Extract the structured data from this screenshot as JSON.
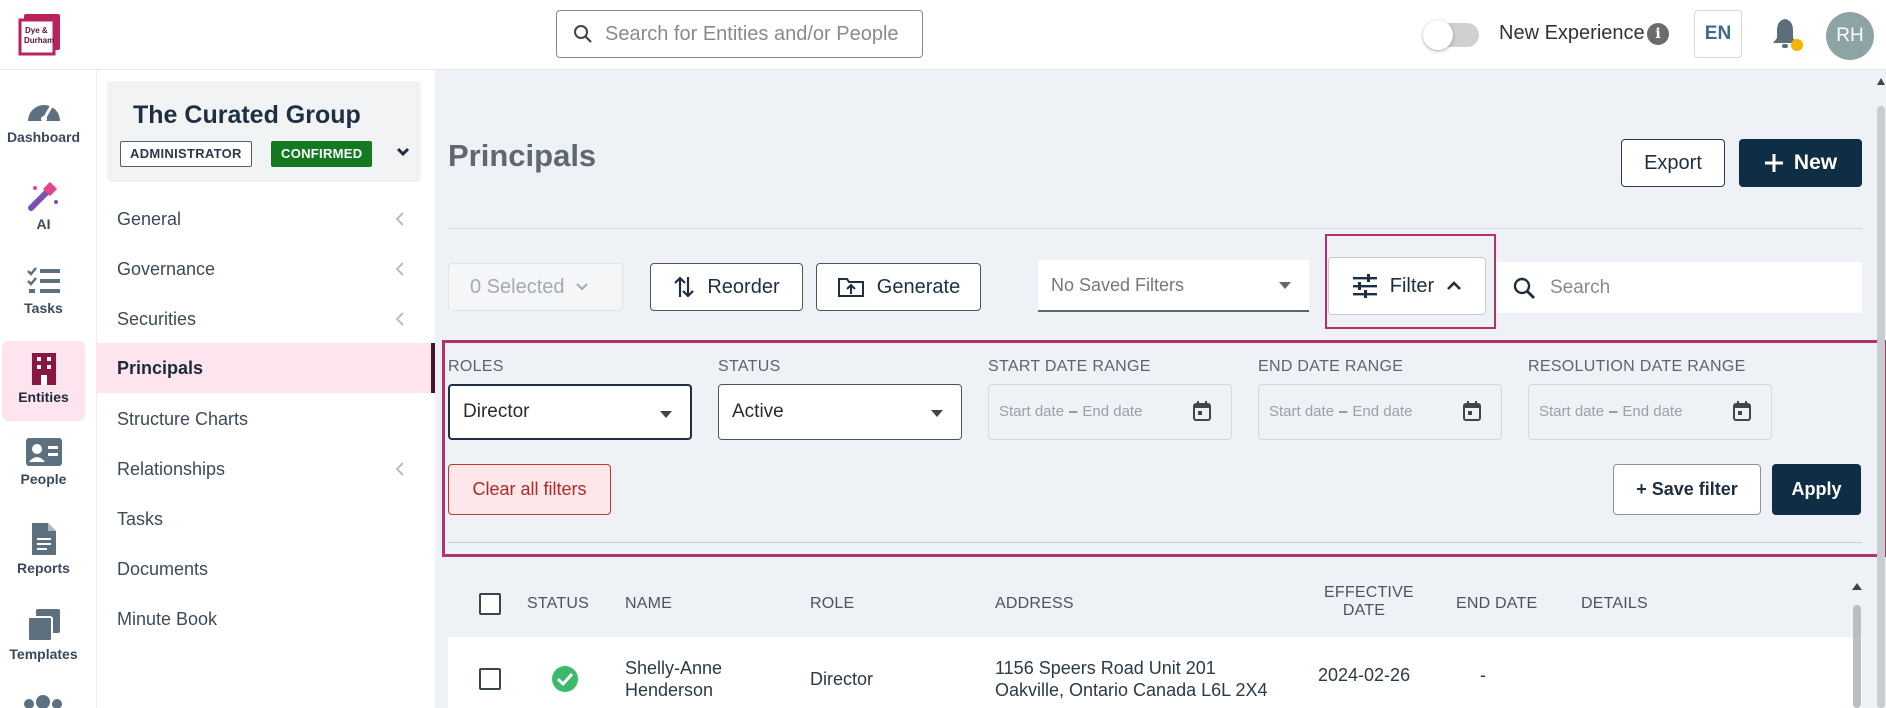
{
  "header": {
    "search_placeholder": "Search for Entities and/or People",
    "new_experience_label": "New Experience",
    "language": "EN",
    "user_initials": "RH"
  },
  "rail": {
    "items": [
      {
        "label": "Dashboard",
        "icon": "gauge-icon"
      },
      {
        "label": "AI",
        "icon": "magic-wand-icon"
      },
      {
        "label": "Tasks",
        "icon": "checklist-icon"
      },
      {
        "label": "Entities",
        "icon": "building-icon",
        "active": true
      },
      {
        "label": "People",
        "icon": "id-card-icon"
      },
      {
        "label": "Reports",
        "icon": "document-icon"
      },
      {
        "label": "Templates",
        "icon": "copy-icon"
      }
    ]
  },
  "entity": {
    "name": "The Curated Group",
    "role_badge": "ADMINISTRATOR",
    "status_badge": "CONFIRMED"
  },
  "subnav": {
    "items": [
      {
        "label": "General",
        "expandable": true
      },
      {
        "label": "Governance",
        "expandable": true
      },
      {
        "label": "Securities",
        "expandable": true
      },
      {
        "label": "Principals",
        "active": true
      },
      {
        "label": "Structure Charts"
      },
      {
        "label": "Relationships",
        "expandable": true
      },
      {
        "label": "Tasks"
      },
      {
        "label": "Documents"
      },
      {
        "label": "Minute Book"
      }
    ]
  },
  "main": {
    "title": "Principals",
    "export_label": "Export",
    "new_label": "New",
    "selected_label": "0 Selected",
    "reorder_label": "Reorder",
    "generate_label": "Generate",
    "saved_filters": "No Saved Filters",
    "filter_label": "Filter",
    "search_placeholder": "Search"
  },
  "filters": {
    "roles_label": "ROLES",
    "roles_value": "Director",
    "status_label": "STATUS",
    "status_value": "Active",
    "start_label": "START DATE RANGE",
    "end_label": "END DATE RANGE",
    "resolution_label": "RESOLUTION DATE RANGE",
    "start_placeholder": "Start date",
    "end_placeholder": "End date",
    "clear_label": "Clear all filters",
    "save_label": "+ Save filter",
    "apply_label": "Apply"
  },
  "table": {
    "columns": {
      "status": "STATUS",
      "name": "NAME",
      "role": "ROLE",
      "address": "ADDRESS",
      "effective_line1": "EFFECTIVE",
      "effective_line2": "DATE",
      "end_date": "END DATE",
      "details": "DETAILS"
    },
    "rows": [
      {
        "status": "active",
        "name_line1": "Shelly-Anne",
        "name_line2": "Henderson",
        "role": "Director",
        "address_line1": "1156 Speers Road Unit 201",
        "address_line2": "Oakville, Ontario Canada L6L 2X4",
        "effective_date": "2024-02-26",
        "end_date": "-"
      }
    ]
  },
  "colors": {
    "brand": "#b4326a",
    "primary": "#0f2d45",
    "confirmed": "#137a22",
    "active_status": "#3cba6b"
  }
}
